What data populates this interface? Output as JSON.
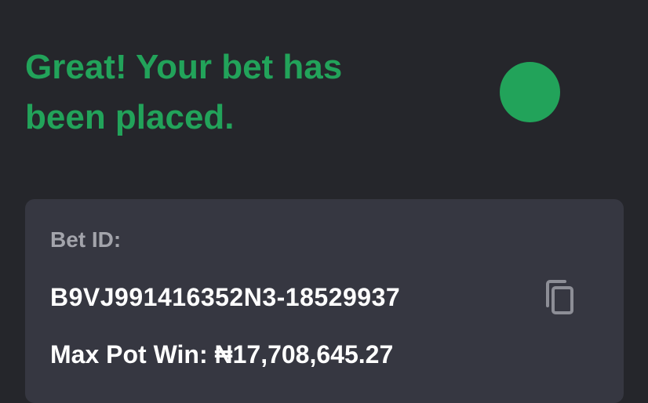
{
  "header": {
    "message": "Great! Your bet has been placed.",
    "accent_color": "#22a35a"
  },
  "bet": {
    "id_label": "Bet ID:",
    "id_value": "B9VJ991416352N3-18529937",
    "copy_icon": "copy-icon",
    "max_pot_win_label": "Max Pot Win:",
    "max_pot_win_value": "₦17,708,645.27"
  }
}
